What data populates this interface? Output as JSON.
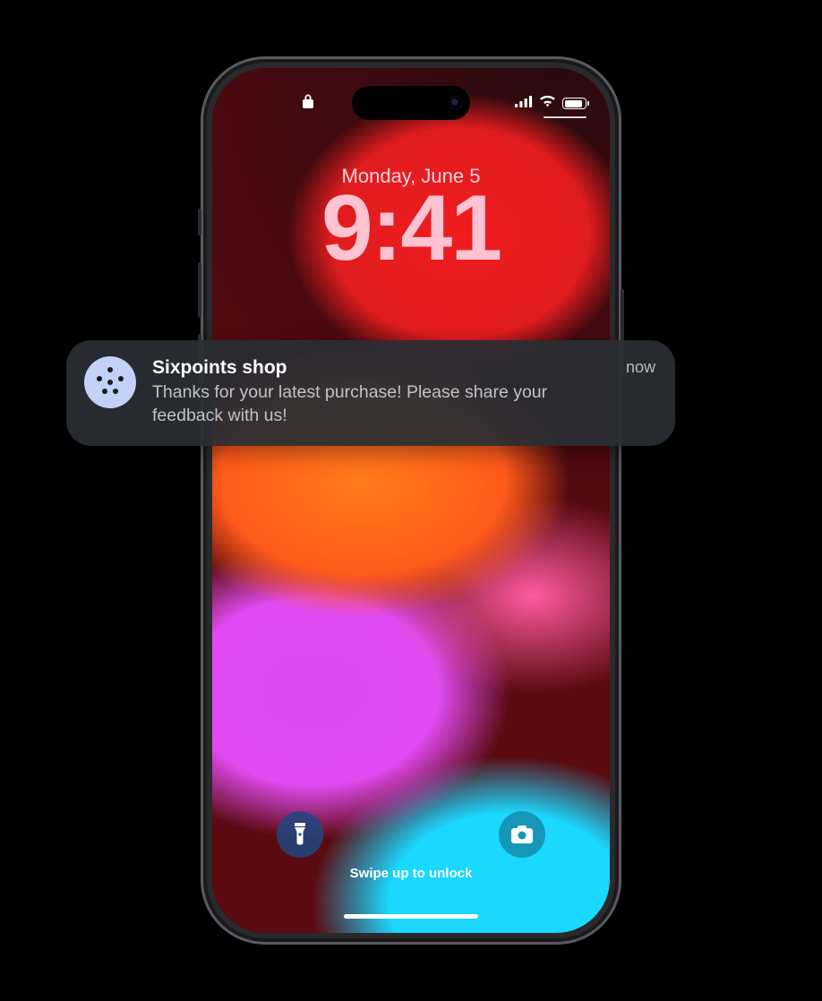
{
  "statusbar": {
    "lock_icon": "lock-icon",
    "cellular_icon": "cellular-signal-icon",
    "wifi_icon": "wifi-icon",
    "battery_icon": "battery-icon"
  },
  "lockscreen": {
    "date": "Monday, June 5",
    "time": "9:41",
    "swipe_hint": "Swipe up to unlock",
    "flashlight_icon": "flashlight-icon",
    "camera_icon": "camera-icon"
  },
  "notification": {
    "app_name": "Sixpoints shop",
    "message": "Thanks for your latest purchase! Please share your feedback with us!",
    "timestamp": "now",
    "app_icon": "sixpoints-app-icon"
  }
}
